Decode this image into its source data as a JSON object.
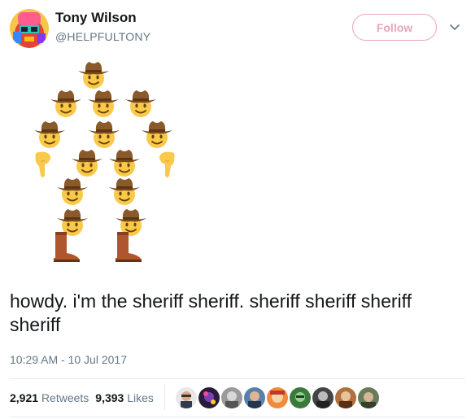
{
  "user": {
    "name": "Tony Wilson",
    "handle": "@HELPFULTONY",
    "avatar_icon": "colorful-portrait-avatar"
  },
  "actions": {
    "follow_label": "Follow",
    "more_icon": "chevron-down-icon"
  },
  "media": {
    "description_icon": "cowboy-emoji-sheriff-art",
    "emoji_glyphs": [
      "cowboy-face",
      "backhand-index-pointing-down",
      "cowboy-boot"
    ]
  },
  "tweet": {
    "text": "howdy. i'm the sheriff sheriff. sheriff sheriff sheriff sheriff",
    "timestamp": "10:29 AM - 10 Jul 2017"
  },
  "stats": {
    "retweets_count": "2,921",
    "retweets_label": "Retweets",
    "likes_count": "9,393",
    "likes_label": "Likes"
  },
  "likers": {
    "count_shown": 9
  },
  "colors": {
    "follow_accent": "#e8a4b8",
    "secondary_text": "#657786",
    "divider": "#e6ecf0",
    "emoji_yellow": "#fbc94a",
    "hat_brown": "#8b5a2b",
    "boot_brown": "#a0522d"
  }
}
